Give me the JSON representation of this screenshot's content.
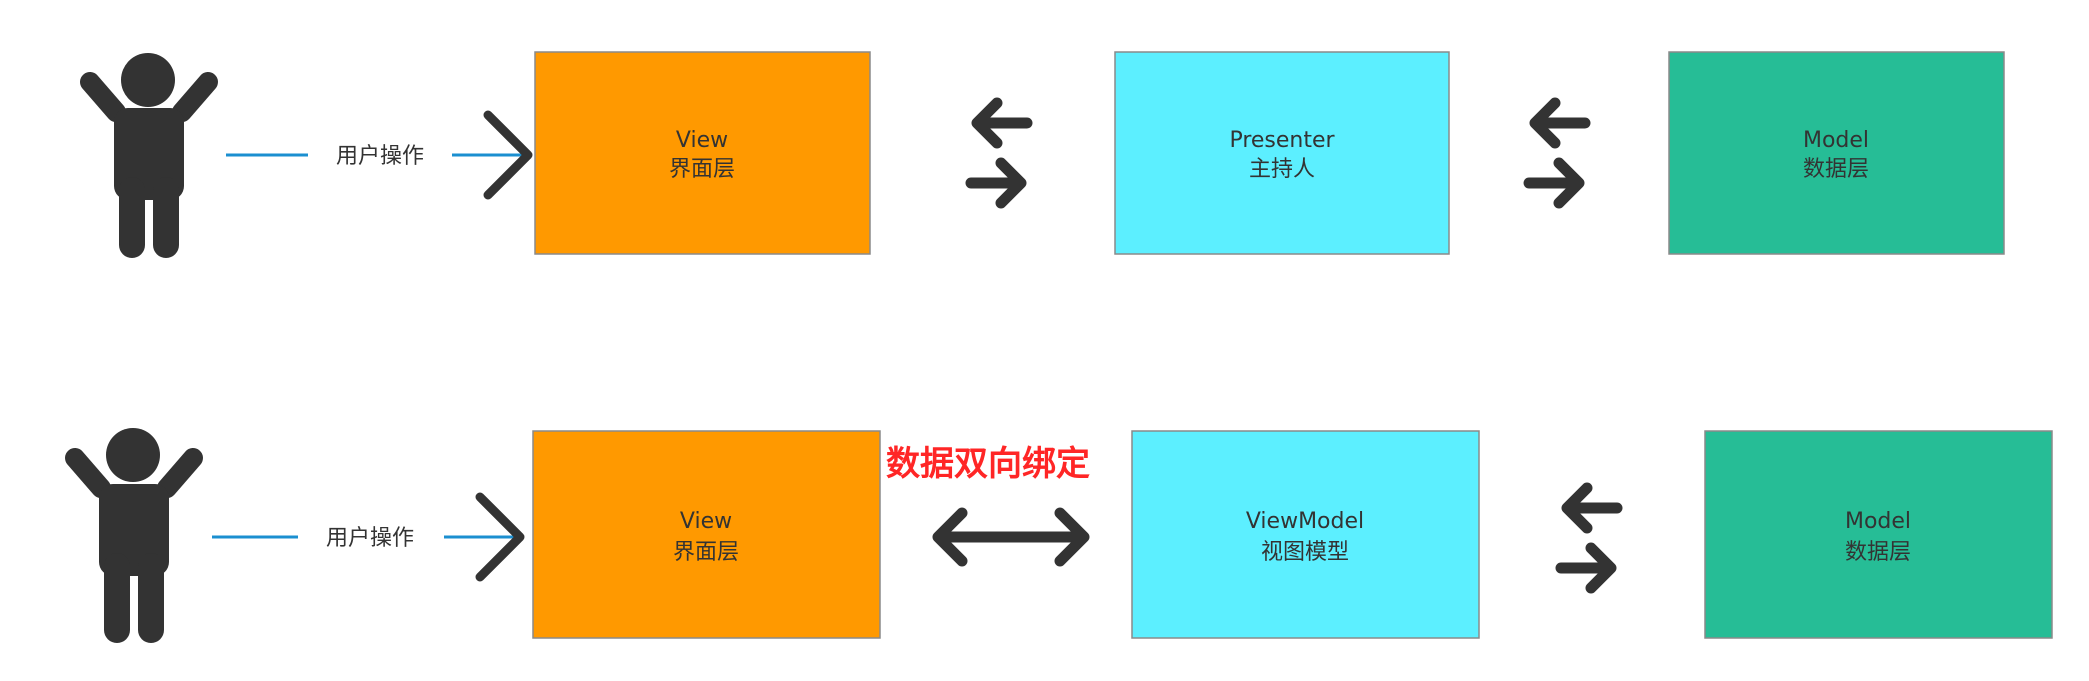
{
  "colors": {
    "view": "#ff9900",
    "presenter": "#5cefff",
    "model": "#26bd96",
    "figure": "#333333",
    "connector": "#1b8fd0",
    "binding_text": "#ff2626"
  },
  "mvp": {
    "action_label": "用户操作",
    "view": {
      "title": "View",
      "subtitle": "界面层"
    },
    "presenter": {
      "title": "Presenter",
      "subtitle": "主持人"
    },
    "model": {
      "title": "Model",
      "subtitle": "数据层"
    }
  },
  "mvvm": {
    "action_label": "用户操作",
    "binding_label": "数据双向绑定",
    "view": {
      "title": "View",
      "subtitle": "界面层"
    },
    "viewmodel": {
      "title": "ViewModel",
      "subtitle": "视图模型"
    },
    "model": {
      "title": "Model",
      "subtitle": "数据层"
    }
  },
  "icons": {
    "user": "person-arms-up-icon",
    "chevron": "chevron-right-icon",
    "exchange": "exchange-arrows-icon",
    "double": "double-headed-arrow-icon"
  }
}
